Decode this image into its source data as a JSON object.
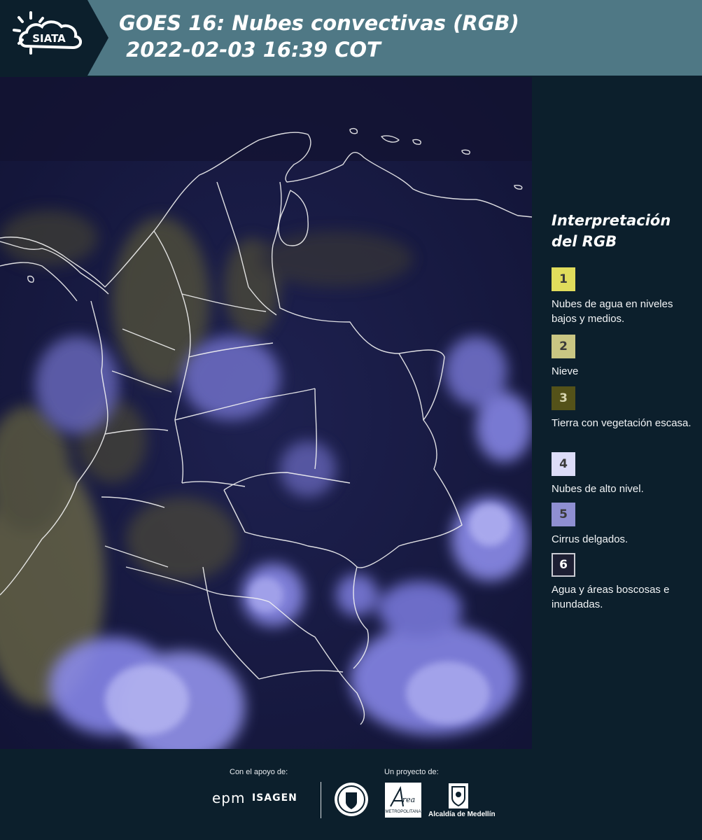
{
  "header": {
    "logo_text": "SIATA",
    "title_line1": "GOES 16: Nubes convectivas (RGB)",
    "title_line2": " 2022-02-03 16:39 COT",
    "background_color": "#4f7885",
    "logo_background_color": "#0c1f2c"
  },
  "legend": {
    "title": "Interpretación del RGB",
    "items": [
      {
        "number": "1",
        "label": "Nubes de agua en niveles bajos y medios.",
        "color": "#e0dc5c"
      },
      {
        "number": "2",
        "label": "Nieve",
        "color": "#c9c683"
      },
      {
        "number": "3",
        "label": "Tierra con vegetación escasa.",
        "color": "#545219"
      },
      {
        "number": "4",
        "label": "Nubes de alto nivel.",
        "color": "#dcdcf8"
      },
      {
        "number": "5",
        "label": "Cirrus delgados.",
        "color": "#8f8fd2"
      },
      {
        "number": "6",
        "label": "Agua y áreas boscosas e inundadas.",
        "color": "#1d1f33"
      }
    ]
  },
  "footer": {
    "support_label": "Con el apoyo de:",
    "project_label": "Un proyecto de:",
    "sponsor_epm": "epm",
    "sponsor_isagen": "ISAGEN",
    "partner_metropolitana": "METROPOLITANA",
    "partner_alcaldia": "Alcaldía de Medellín"
  },
  "map": {
    "background_color": "#181a44",
    "cloud_high_color": "#8d8df7",
    "cloud_low_color": "#c9c77a"
  }
}
